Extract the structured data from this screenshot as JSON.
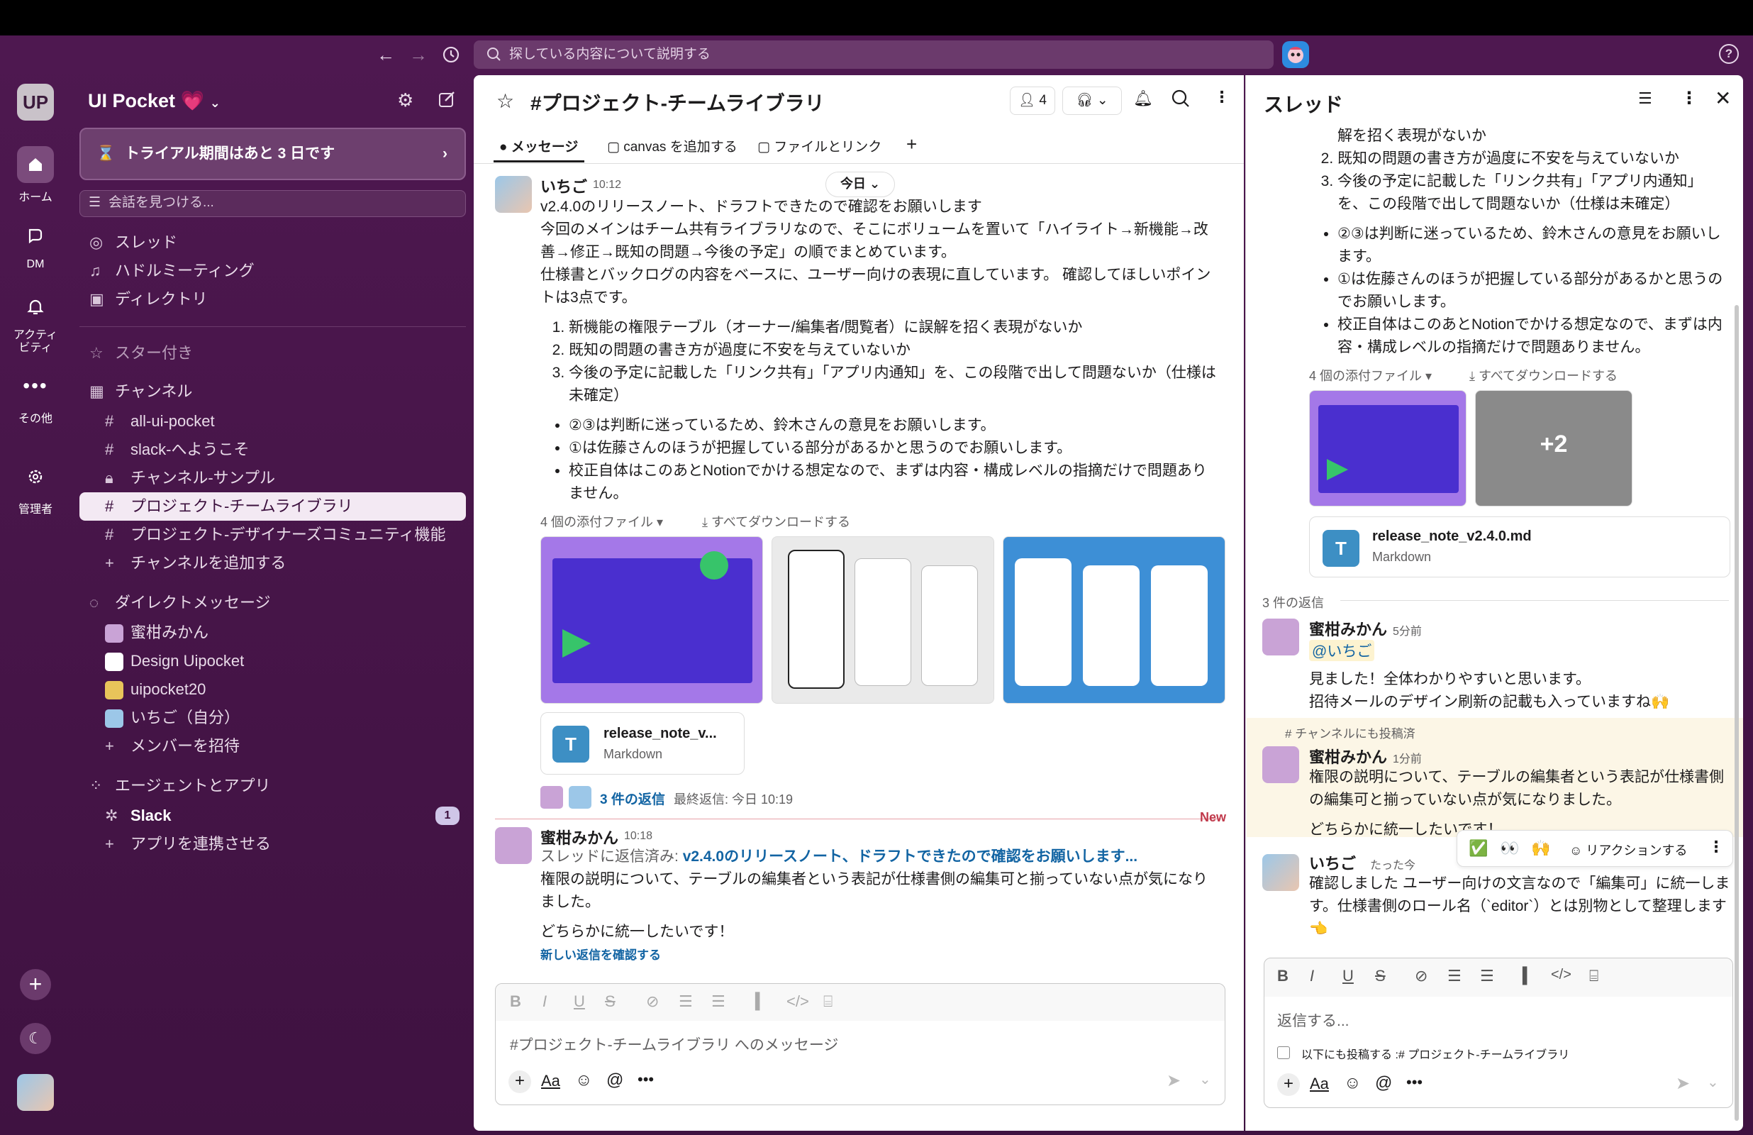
{
  "topbar": {
    "search_placeholder": "探している内容について説明する"
  },
  "rail": {
    "workspace_initials": "UP",
    "items": [
      {
        "label": "ホーム"
      },
      {
        "label": "DM"
      },
      {
        "label": "アクティビティ"
      },
      {
        "label": "その他"
      },
      {
        "label": "管理者"
      }
    ]
  },
  "sidebar": {
    "workspace_name": "UI Pocket 💗",
    "trial_banner": "トライアル期間はあと 3 日です",
    "find_placeholder": "会話を見つける...",
    "nav": [
      "スレッド",
      "ハドルミーティング",
      "ディレクトリ"
    ],
    "starred_header": "スター付き",
    "channels_header": "チャンネル",
    "channels": [
      "all-ui-pocket",
      "slack-へようこそ",
      "チャンネル-サンプル",
      "プロジェクト-チームライブラリ",
      "プロジェクト-デザイナーズコミュニティ機能"
    ],
    "add_channel": "チャンネルを追加する",
    "dm_header": "ダイレクトメッセージ",
    "dms": [
      "蜜柑みかん",
      "Design Uipocket",
      "uipocket20",
      "いちご（自分）"
    ],
    "invite": "メンバーを招待",
    "apps_header": "エージェントとアプリ",
    "apps": [
      {
        "name": "Slack",
        "badge": "1"
      }
    ],
    "connect_app": "アプリを連携させる"
  },
  "channel": {
    "title": "#プロジェクト-チームライブラリ",
    "member_count": "4",
    "tabs": [
      "メッセージ",
      "canvas を追加する",
      "ファイルとリンク"
    ],
    "date_pill": "今日",
    "message1": {
      "author": "いちご",
      "time": "10:12",
      "lines": [
        "v2.4.0のリリースノート、ドラフトできたので確認をお願いします",
        "今回のメインはチーム共有ライブラリなので、そこにボリュームを置いて「ハイライト→新機能→改善→修正→既知の問題→今後の予定」の順でまとめています。",
        "仕様書とバックログの内容をベースに、ユーザー向けの表現に直しています。 確認してほしいポイントは3点です。"
      ],
      "ordered": [
        "新機能の権限テーブル（オーナー/編集者/閲覧者）に誤解を招く表現がないか",
        "既知の問題の書き方が過度に不安を与えていないか",
        "今後の予定に記載した「リンク共有」「アプリ内通知」を、この段階で出して問題ないか（仕様は未確定）"
      ],
      "bullets": [
        "②③は判断に迷っているため、鈴木さんの意見をお願いします。",
        "①は佐藤さんのほうが把握している部分があるかと思うのでお願いします。",
        "校正自体はこのあとNotionでかける想定なので、まずは内容・構成レベルの指摘だけで問題ありません。"
      ],
      "attachments_label": "4 個の添付ファイル",
      "download_all": "すべてダウンロードする",
      "file_name": "release_note_v...",
      "file_type": "Markdown",
      "replies": "3 件の返信",
      "last_reply": "最終返信: 今日 10:19"
    },
    "new_label": "New",
    "message2": {
      "author": "蜜柑みかん",
      "time": "10:18",
      "reply_prefix": "スレッドに返信済み:",
      "reply_link": "v2.4.0のリリースノート、ドラフトできたので確認をお願いします...",
      "text": "権限の説明について、テーブルの編集者という表記が仕様書側の編集可と揃っていない点が気になりました。",
      "text2": "どちらかに統一したいです！",
      "new_replies": "新しい返信を確認する"
    },
    "composer_placeholder": "#プロジェクト-チームライブラリ へのメッセージ"
  },
  "thread": {
    "title": "スレッド",
    "top_text": "解を招く表現がないか",
    "ordered": [
      "既知の問題の書き方が過度に不安を与えていないか",
      "今後の予定に記載した「リンク共有」「アプリ内通知」を、この段階で出して問題ないか（仕様は未確定）"
    ],
    "bullets": [
      "②③は判断に迷っているため、鈴木さんの意見をお願いします。",
      "①は佐藤さんのほうが把握している部分があるかと思うのでお願いします。",
      "校正自体はこのあとNotionでかける想定なので、まずは内容・構成レベルの指摘だけで問題ありません。"
    ],
    "attachments_label": "4 個の添付ファイル",
    "download_all": "すべてダウンロードする",
    "more_count": "+2",
    "file_name": "release_note_v2.4.0.md",
    "file_type": "Markdown",
    "reply_count": "3 件の返信",
    "r1": {
      "author": "蜜柑みかん",
      "time": "5分前",
      "mention": "@いちご",
      "text1": "見ました！全体わかりやすいと思います。",
      "text2": "招待メールのデザイン刷新の記載も入っていますね🙌"
    },
    "also_posted": "チャンネルにも投稿済",
    "r2": {
      "author": "蜜柑みかん",
      "time": "1分前",
      "text1": "権限の説明について、テーブルの編集者という表記が仕様書側の編集可と揃っていない点が気になりました。",
      "text2": "どちらかに統一したいです！"
    },
    "reactions": {
      "emoji1": "✅",
      "emoji2": "👀",
      "emoji3": "🙌",
      "label": "リアクションする"
    },
    "r3": {
      "author": "いちご",
      "time": "たった今",
      "text": "確認しました ユーザー向けの文言なので「編集可」に統一します。仕様書側のロール名（`editor`）とは別物として整理します👈"
    },
    "composer_placeholder": "返信する...",
    "also_post_label": "以下にも投稿する :# プロジェクト-チームライブラリ"
  }
}
